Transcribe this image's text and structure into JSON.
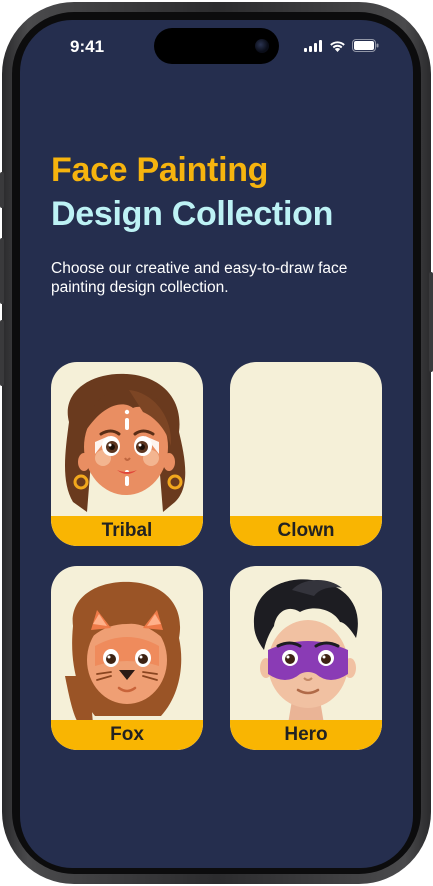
{
  "status_bar": {
    "time": "9:41"
  },
  "header": {
    "title_line1": "Face Painting",
    "title_line2": "Design Collection",
    "subtitle": "Choose our creative and easy-to-draw face painting design collection."
  },
  "designs": [
    {
      "label": "Tribal"
    },
    {
      "label": "Clown"
    },
    {
      "label": "Fox"
    },
    {
      "label": "Hero"
    }
  ],
  "colors": {
    "background": "#252e4e",
    "title_accent": "#f6b40e",
    "title_secondary": "#bdf2f5",
    "card_background": "#f5f0d8",
    "card_label_bar": "#f9b502"
  }
}
